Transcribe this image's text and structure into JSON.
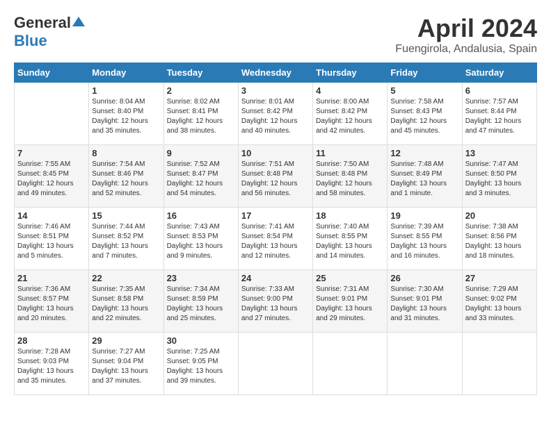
{
  "header": {
    "logo_general": "General",
    "logo_blue": "Blue",
    "title": "April 2024",
    "location": "Fuengirola, Andalusia, Spain"
  },
  "columns": [
    "Sunday",
    "Monday",
    "Tuesday",
    "Wednesday",
    "Thursday",
    "Friday",
    "Saturday"
  ],
  "weeks": [
    [
      {
        "day": "",
        "sunrise": "",
        "sunset": "",
        "daylight": ""
      },
      {
        "day": "1",
        "sunrise": "Sunrise: 8:04 AM",
        "sunset": "Sunset: 8:40 PM",
        "daylight": "Daylight: 12 hours and 35 minutes."
      },
      {
        "day": "2",
        "sunrise": "Sunrise: 8:02 AM",
        "sunset": "Sunset: 8:41 PM",
        "daylight": "Daylight: 12 hours and 38 minutes."
      },
      {
        "day": "3",
        "sunrise": "Sunrise: 8:01 AM",
        "sunset": "Sunset: 8:42 PM",
        "daylight": "Daylight: 12 hours and 40 minutes."
      },
      {
        "day": "4",
        "sunrise": "Sunrise: 8:00 AM",
        "sunset": "Sunset: 8:42 PM",
        "daylight": "Daylight: 12 hours and 42 minutes."
      },
      {
        "day": "5",
        "sunrise": "Sunrise: 7:58 AM",
        "sunset": "Sunset: 8:43 PM",
        "daylight": "Daylight: 12 hours and 45 minutes."
      },
      {
        "day": "6",
        "sunrise": "Sunrise: 7:57 AM",
        "sunset": "Sunset: 8:44 PM",
        "daylight": "Daylight: 12 hours and 47 minutes."
      }
    ],
    [
      {
        "day": "7",
        "sunrise": "Sunrise: 7:55 AM",
        "sunset": "Sunset: 8:45 PM",
        "daylight": "Daylight: 12 hours and 49 minutes."
      },
      {
        "day": "8",
        "sunrise": "Sunrise: 7:54 AM",
        "sunset": "Sunset: 8:46 PM",
        "daylight": "Daylight: 12 hours and 52 minutes."
      },
      {
        "day": "9",
        "sunrise": "Sunrise: 7:52 AM",
        "sunset": "Sunset: 8:47 PM",
        "daylight": "Daylight: 12 hours and 54 minutes."
      },
      {
        "day": "10",
        "sunrise": "Sunrise: 7:51 AM",
        "sunset": "Sunset: 8:48 PM",
        "daylight": "Daylight: 12 hours and 56 minutes."
      },
      {
        "day": "11",
        "sunrise": "Sunrise: 7:50 AM",
        "sunset": "Sunset: 8:48 PM",
        "daylight": "Daylight: 12 hours and 58 minutes."
      },
      {
        "day": "12",
        "sunrise": "Sunrise: 7:48 AM",
        "sunset": "Sunset: 8:49 PM",
        "daylight": "Daylight: 13 hours and 1 minute."
      },
      {
        "day": "13",
        "sunrise": "Sunrise: 7:47 AM",
        "sunset": "Sunset: 8:50 PM",
        "daylight": "Daylight: 13 hours and 3 minutes."
      }
    ],
    [
      {
        "day": "14",
        "sunrise": "Sunrise: 7:46 AM",
        "sunset": "Sunset: 8:51 PM",
        "daylight": "Daylight: 13 hours and 5 minutes."
      },
      {
        "day": "15",
        "sunrise": "Sunrise: 7:44 AM",
        "sunset": "Sunset: 8:52 PM",
        "daylight": "Daylight: 13 hours and 7 minutes."
      },
      {
        "day": "16",
        "sunrise": "Sunrise: 7:43 AM",
        "sunset": "Sunset: 8:53 PM",
        "daylight": "Daylight: 13 hours and 9 minutes."
      },
      {
        "day": "17",
        "sunrise": "Sunrise: 7:41 AM",
        "sunset": "Sunset: 8:54 PM",
        "daylight": "Daylight: 13 hours and 12 minutes."
      },
      {
        "day": "18",
        "sunrise": "Sunrise: 7:40 AM",
        "sunset": "Sunset: 8:55 PM",
        "daylight": "Daylight: 13 hours and 14 minutes."
      },
      {
        "day": "19",
        "sunrise": "Sunrise: 7:39 AM",
        "sunset": "Sunset: 8:55 PM",
        "daylight": "Daylight: 13 hours and 16 minutes."
      },
      {
        "day": "20",
        "sunrise": "Sunrise: 7:38 AM",
        "sunset": "Sunset: 8:56 PM",
        "daylight": "Daylight: 13 hours and 18 minutes."
      }
    ],
    [
      {
        "day": "21",
        "sunrise": "Sunrise: 7:36 AM",
        "sunset": "Sunset: 8:57 PM",
        "daylight": "Daylight: 13 hours and 20 minutes."
      },
      {
        "day": "22",
        "sunrise": "Sunrise: 7:35 AM",
        "sunset": "Sunset: 8:58 PM",
        "daylight": "Daylight: 13 hours and 22 minutes."
      },
      {
        "day": "23",
        "sunrise": "Sunrise: 7:34 AM",
        "sunset": "Sunset: 8:59 PM",
        "daylight": "Daylight: 13 hours and 25 minutes."
      },
      {
        "day": "24",
        "sunrise": "Sunrise: 7:33 AM",
        "sunset": "Sunset: 9:00 PM",
        "daylight": "Daylight: 13 hours and 27 minutes."
      },
      {
        "day": "25",
        "sunrise": "Sunrise: 7:31 AM",
        "sunset": "Sunset: 9:01 PM",
        "daylight": "Daylight: 13 hours and 29 minutes."
      },
      {
        "day": "26",
        "sunrise": "Sunrise: 7:30 AM",
        "sunset": "Sunset: 9:01 PM",
        "daylight": "Daylight: 13 hours and 31 minutes."
      },
      {
        "day": "27",
        "sunrise": "Sunrise: 7:29 AM",
        "sunset": "Sunset: 9:02 PM",
        "daylight": "Daylight: 13 hours and 33 minutes."
      }
    ],
    [
      {
        "day": "28",
        "sunrise": "Sunrise: 7:28 AM",
        "sunset": "Sunset: 9:03 PM",
        "daylight": "Daylight: 13 hours and 35 minutes."
      },
      {
        "day": "29",
        "sunrise": "Sunrise: 7:27 AM",
        "sunset": "Sunset: 9:04 PM",
        "daylight": "Daylight: 13 hours and 37 minutes."
      },
      {
        "day": "30",
        "sunrise": "Sunrise: 7:25 AM",
        "sunset": "Sunset: 9:05 PM",
        "daylight": "Daylight: 13 hours and 39 minutes."
      },
      {
        "day": "",
        "sunrise": "",
        "sunset": "",
        "daylight": ""
      },
      {
        "day": "",
        "sunrise": "",
        "sunset": "",
        "daylight": ""
      },
      {
        "day": "",
        "sunrise": "",
        "sunset": "",
        "daylight": ""
      },
      {
        "day": "",
        "sunrise": "",
        "sunset": "",
        "daylight": ""
      }
    ]
  ]
}
